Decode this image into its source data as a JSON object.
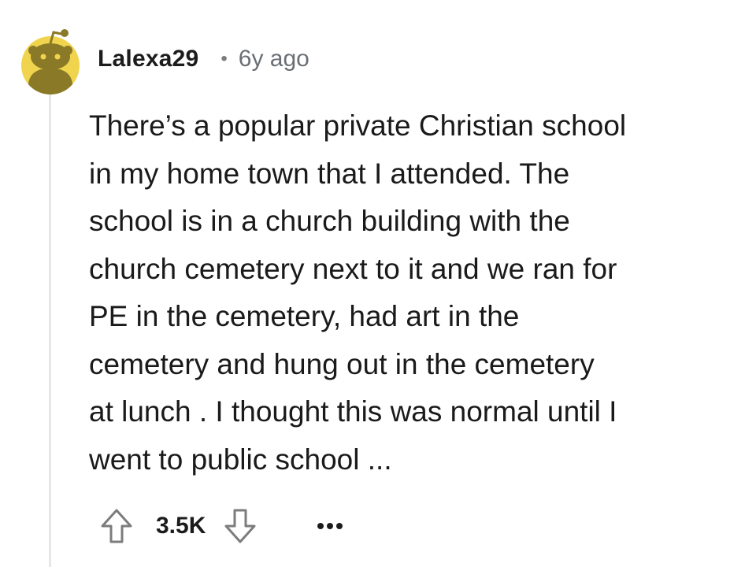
{
  "comment": {
    "author": "Lalexa29",
    "separator": "•",
    "timestamp": "6y ago",
    "body_lines": [
      "There’s a popular private Christian school",
      "in my home town that I attended. The",
      "school is in a church building with the",
      "church cemetery next to it and we ran for",
      "PE in the cemetery, had art in the",
      "cemetery and hung out in the cemetery",
      "at lunch . I thought this was normal until I",
      "went to public school ..."
    ],
    "vote_score": "3.5K"
  },
  "icons": {
    "avatar": "snoo-avatar-icon",
    "upvote": "arrow-up-icon",
    "downvote": "arrow-down-icon",
    "more": "more-horizontal-icon"
  },
  "colors": {
    "avatar_bg": "#f0d44e",
    "avatar_figure": "#8a7a27",
    "thread_line": "#e5e7eb",
    "meta_text": "#6b6f73"
  }
}
